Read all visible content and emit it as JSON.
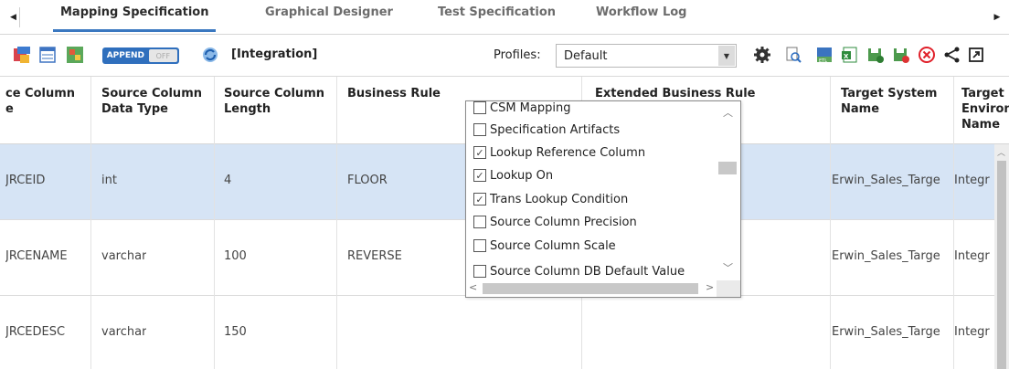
{
  "tabs": [
    "Mapping Specification",
    "Graphical Designer",
    "Test Specification",
    "Workflow Log"
  ],
  "toolbar": {
    "append_on": "APPEND",
    "append_off": "OFF",
    "integration": "[Integration]",
    "profiles_label": "Profiles:",
    "profiles_value": "Default"
  },
  "grid": {
    "headers": {
      "col1": "ce Column\ne",
      "col2": "Source Column\nData Type",
      "col3": "Source Column\nLength",
      "col4": "Business Rule",
      "col5": "Extended Business Rule",
      "col6": "Target System\nName",
      "col7": "Target\nEnviron\nName"
    },
    "rows": [
      {
        "col1": "JRCEID",
        "col2": "int",
        "col3": "4",
        "col4": "FLOOR",
        "col6": "Erwin_Sales_Targe",
        "col7": "Integr"
      },
      {
        "col1": "JRCENAME",
        "col2": "varchar",
        "col3": "100",
        "col4": "REVERSE",
        "col6": "Erwin_Sales_Targe",
        "col7": "Integr"
      },
      {
        "col1": "JRCEDESC",
        "col2": "varchar",
        "col3": "150",
        "col4": "",
        "col6": "Erwin_Sales_Targe",
        "col7": "Integr"
      }
    ]
  },
  "popup": {
    "items": [
      {
        "label": "CSM Mapping",
        "checked": false
      },
      {
        "label": "Specification Artifacts",
        "checked": false
      },
      {
        "label": "Lookup Reference Column",
        "checked": true
      },
      {
        "label": "Lookup On",
        "checked": true
      },
      {
        "label": "Trans Lookup Condition",
        "checked": true
      },
      {
        "label": "Source Column Precision",
        "checked": false
      },
      {
        "label": "Source Column Scale",
        "checked": false
      },
      {
        "label": "Source Column DB Default Value",
        "checked": false
      }
    ]
  }
}
